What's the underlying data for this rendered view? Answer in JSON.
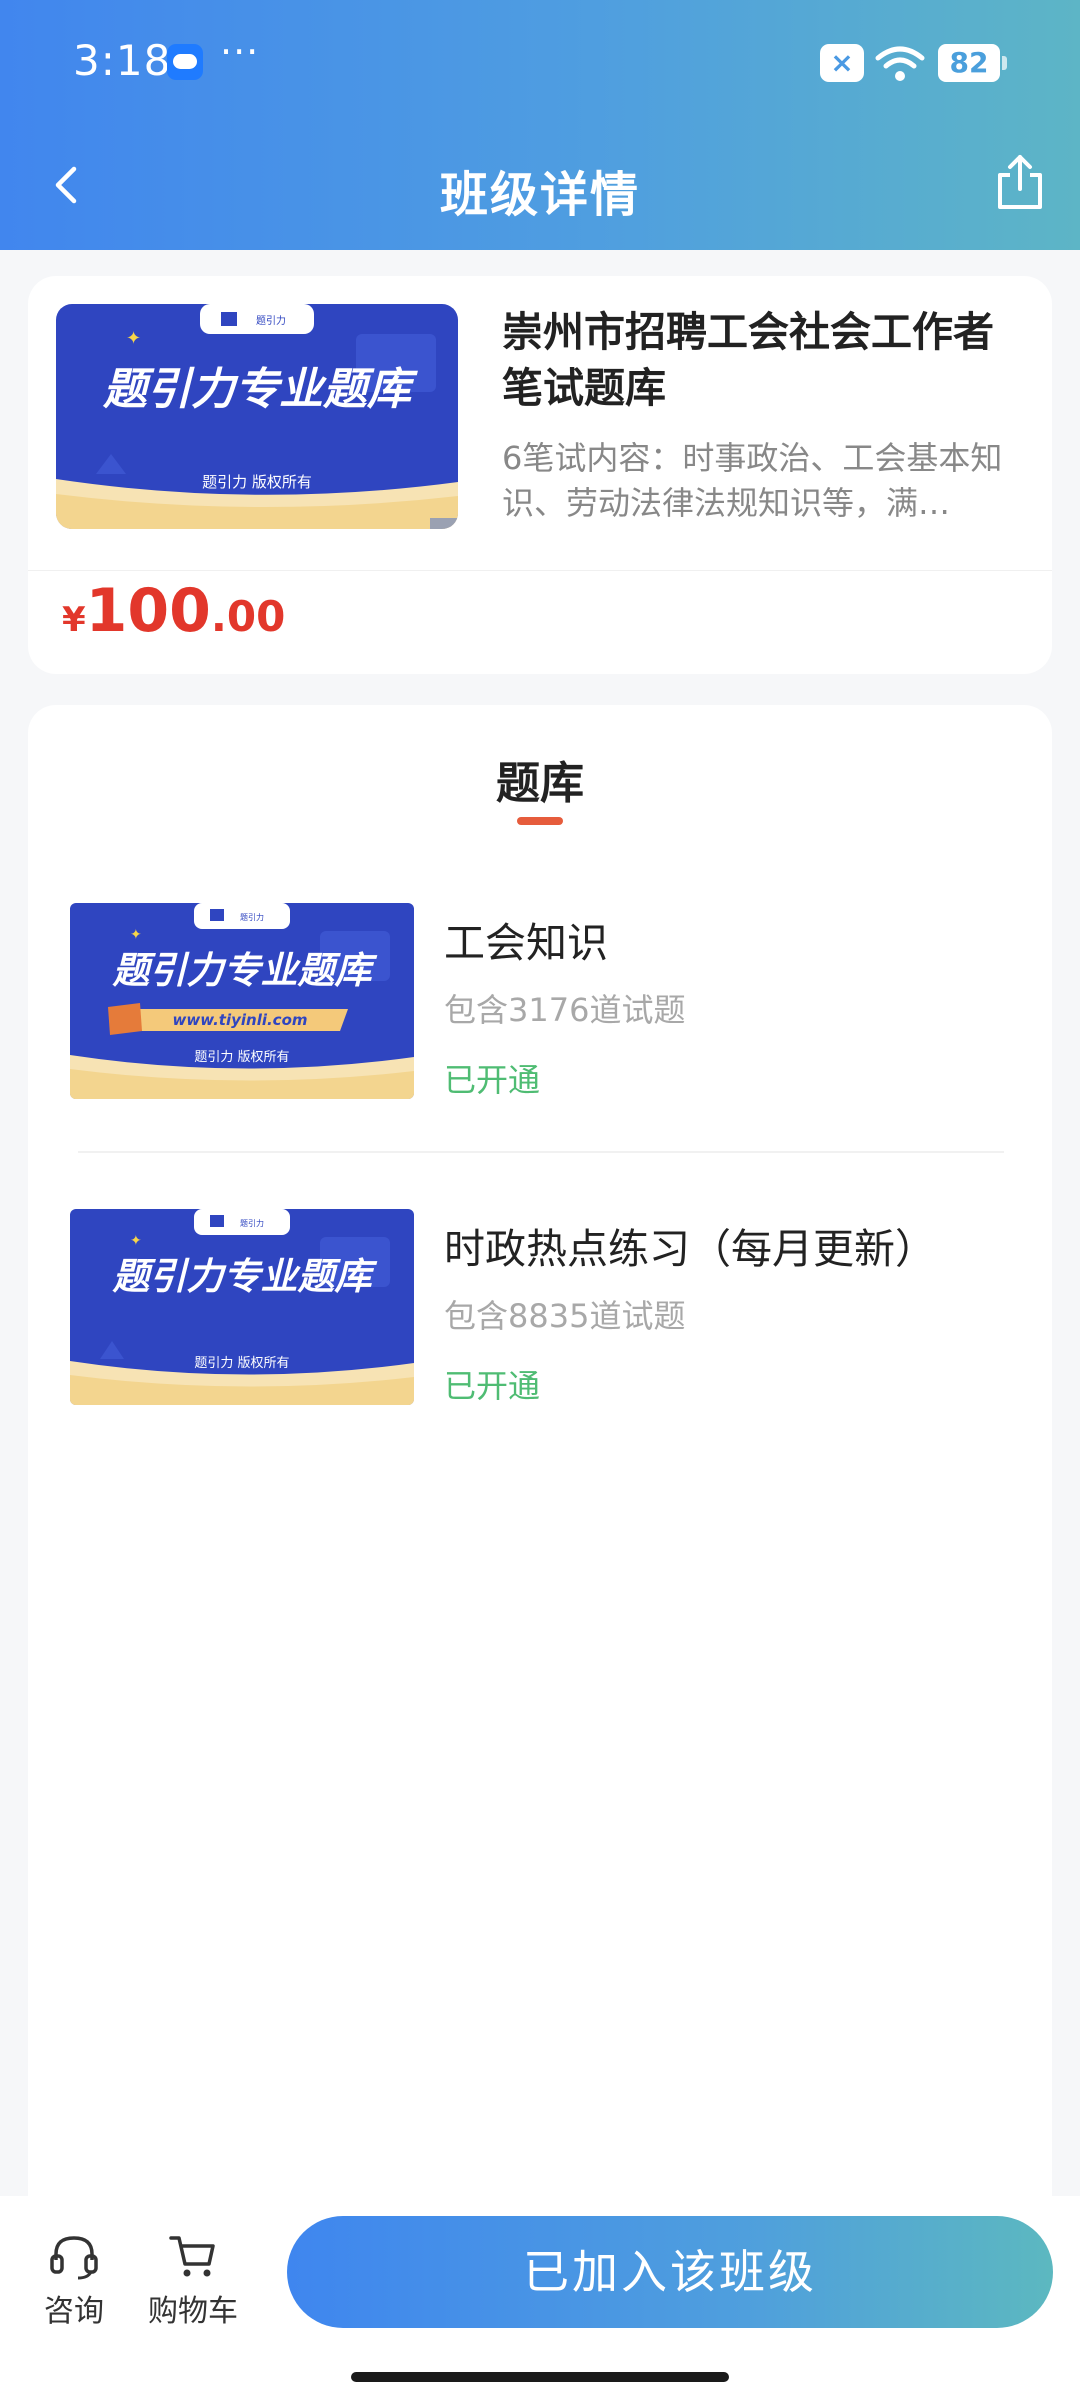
{
  "status_bar": {
    "time": "3:18",
    "more": "···",
    "battery": "82"
  },
  "nav": {
    "title": "班级详情"
  },
  "course": {
    "title": "崇州市招聘工会社会工作者笔试题库",
    "description": "6笔试内容：时事政治、工会基本知识、劳动法律法规知识等，满…",
    "price_symbol": "¥",
    "price_int": "100",
    "price_dec": ".00",
    "cover": {
      "brand": "题引力",
      "headline": "题引力专业题库",
      "copyright": "题引力 版权所有"
    }
  },
  "bank": {
    "tab_title": "题库",
    "items": [
      {
        "name": "工会知识",
        "count": "包含3176道试题",
        "status": "已开通",
        "cover_headline": "题引力专业题库",
        "cover_url": "www.tiyinli.com",
        "cover_copyright": "题引力 版权所有",
        "cover_brand": "题引力"
      },
      {
        "name": "时政热点练习（每月更新）",
        "count": "包含8835道试题",
        "status": "已开通",
        "cover_headline": "题引力专业题库",
        "cover_copyright": "题引力 版权所有",
        "cover_brand": "题引力"
      }
    ]
  },
  "bottom_bar": {
    "consult_label": "咨询",
    "cart_label": "购物车",
    "join_label": "已加入该班级"
  },
  "colors": {
    "header_start": "#4186ee",
    "header_end": "#5db5c6",
    "price": "#e2372b",
    "status_open": "#4fbc73",
    "tab_indicator": "#e65c3c",
    "cover_blue": "#2f45c0"
  }
}
